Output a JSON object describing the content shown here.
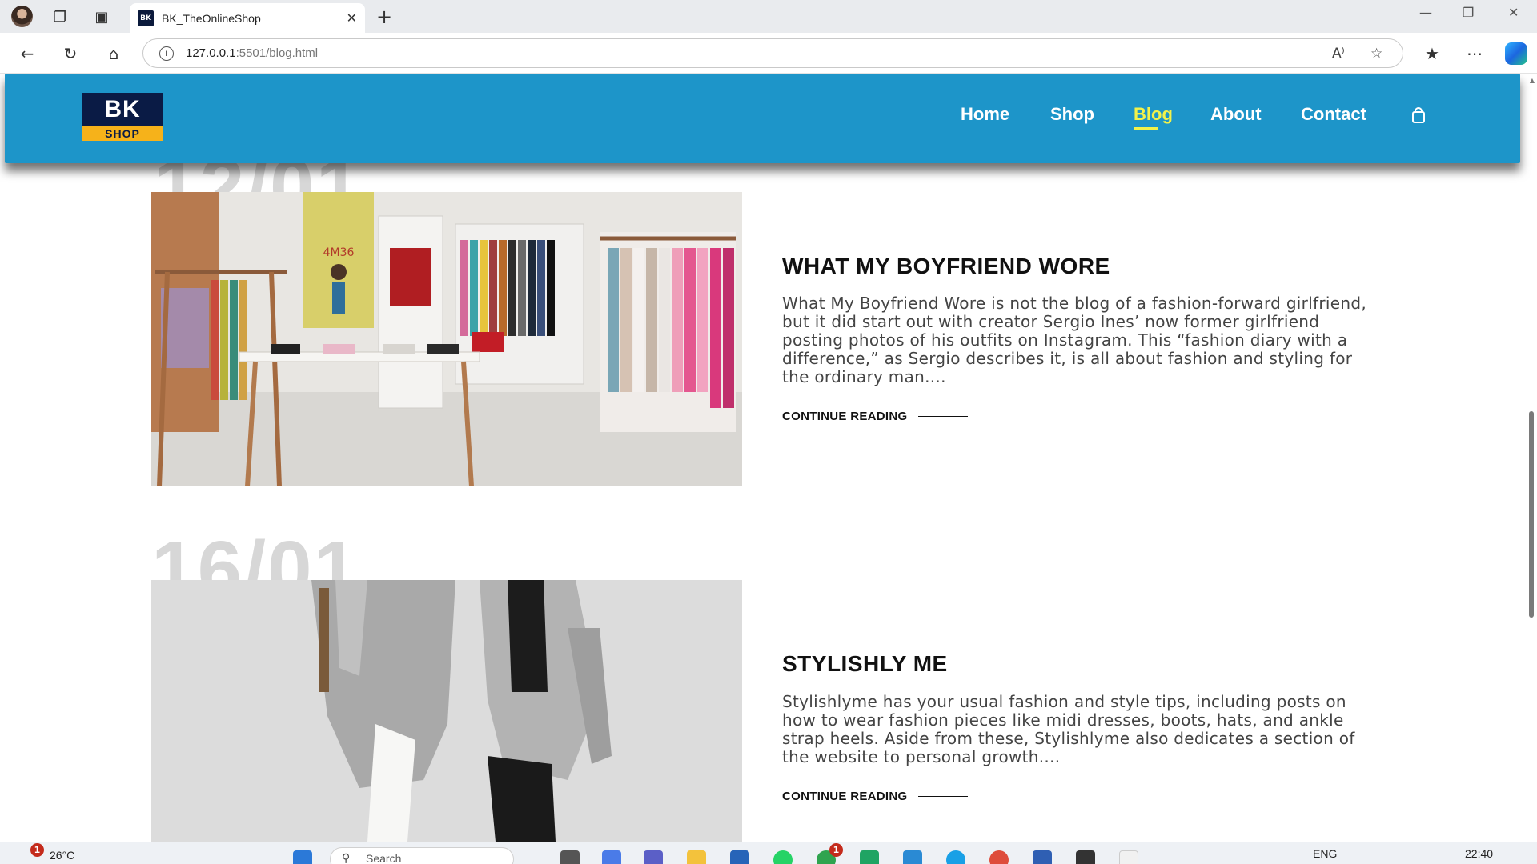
{
  "browser": {
    "tab_title": "BK_TheOnlineShop",
    "tab_favicon": "BK",
    "url_host": "127.0.0.1",
    "url_rest": ":5501/blog.html",
    "read_aloud_label": "A⁾"
  },
  "site": {
    "logo_top": "BK",
    "logo_bottom": "SHOP",
    "nav": [
      {
        "label": "Home"
      },
      {
        "label": "Shop"
      },
      {
        "label": "Blog",
        "active": true
      },
      {
        "label": "About"
      },
      {
        "label": "Contact"
      }
    ],
    "colors": {
      "header": "#1d95c9",
      "active_nav": "#f2f24a",
      "logo_navy": "#0a1b45",
      "logo_yellow": "#f6b21a"
    }
  },
  "posts": [
    {
      "date": "12/01",
      "title": "WHAT MY BOYFRIEND WORE",
      "excerpt": "What My Boyfriend Wore is not the blog of a fashion-forward girlfriend, but it did start out with creator Sergio Ines’ now former girlfriend posting photos of his outfits on Instagram. This “fashion diary with a difference,” as Sergio describes it, is all about fashion and styling for the ordinary man....",
      "read_more": "CONTINUE READING",
      "image_poster_text": "4M36"
    },
    {
      "date": "16/01",
      "title": "STYLISHLY ME",
      "excerpt": "Stylishlyme has your usual fashion and style tips, including posts on how to wear fashion pieces like midi dresses, boots, hats, and ankle strap heels. Aside from these, Stylishlyme also dedicates a section of the website to personal growth....",
      "read_more": "CONTINUE READING"
    }
  ],
  "taskbar": {
    "weather_badge": "1",
    "temperature": "26°C",
    "search_placeholder": "Search",
    "whatsapp_badge": "1",
    "language": "ENG",
    "time": "22:40"
  }
}
